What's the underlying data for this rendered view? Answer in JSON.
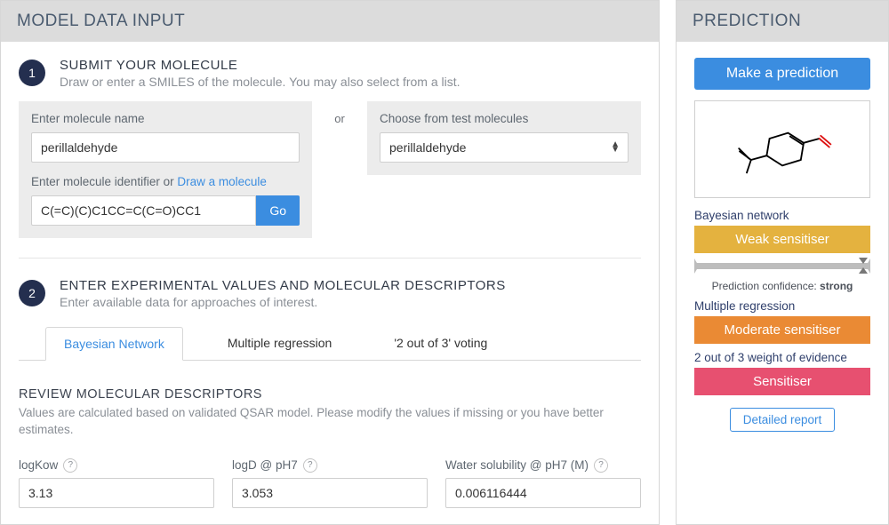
{
  "left": {
    "header": "MODEL DATA INPUT",
    "step1": {
      "num": "1",
      "title": "SUBMIT YOUR MOLECULE",
      "sub": "Draw or enter a SMILES of the molecule. You may also select from a list.",
      "name_label": "Enter molecule name",
      "name_value": "perillaldehyde",
      "id_label_prefix": "Enter molecule identifier or ",
      "draw_link": "Draw a molecule",
      "smiles_value": "C(=C)(C)C1CC=C(C=O)CC1",
      "go_label": "Go",
      "or_label": "or",
      "choose_label": "Choose from test molecules",
      "choose_value": "perillaldehyde"
    },
    "step2": {
      "num": "2",
      "title": "ENTER EXPERIMENTAL VALUES AND MOLECULAR DESCRIPTORS",
      "sub": "Enter available data for approaches of interest."
    },
    "tabs": {
      "bayes": "Bayesian Network",
      "multi": "Multiple regression",
      "voting": "'2 out of 3' voting"
    },
    "review": {
      "title": "REVIEW MOLECULAR DESCRIPTORS",
      "sub": "Values are calculated based on validated QSAR model. Please modify the values if missing or you have better estimates."
    },
    "descriptors": {
      "logkow_label": "logKow",
      "logkow_value": "3.13",
      "logd_label": "logD @ pH7",
      "logd_value": "3.053",
      "ws_label": "Water solubility @ pH7 (M)",
      "ws_value": "0.006116444"
    }
  },
  "right": {
    "header": "PREDICTION",
    "predict_btn": "Make a prediction",
    "bayes_label": "Bayesian network",
    "bayes_result": "Weak sensitiser",
    "conf_prefix": "Prediction confidence: ",
    "conf_value": "strong",
    "multi_label": "Multiple regression",
    "multi_result": "Moderate sensitiser",
    "voting_label": "2 out of 3 weight of evidence",
    "voting_result": "Sensitiser",
    "detail_btn": "Detailed report"
  }
}
